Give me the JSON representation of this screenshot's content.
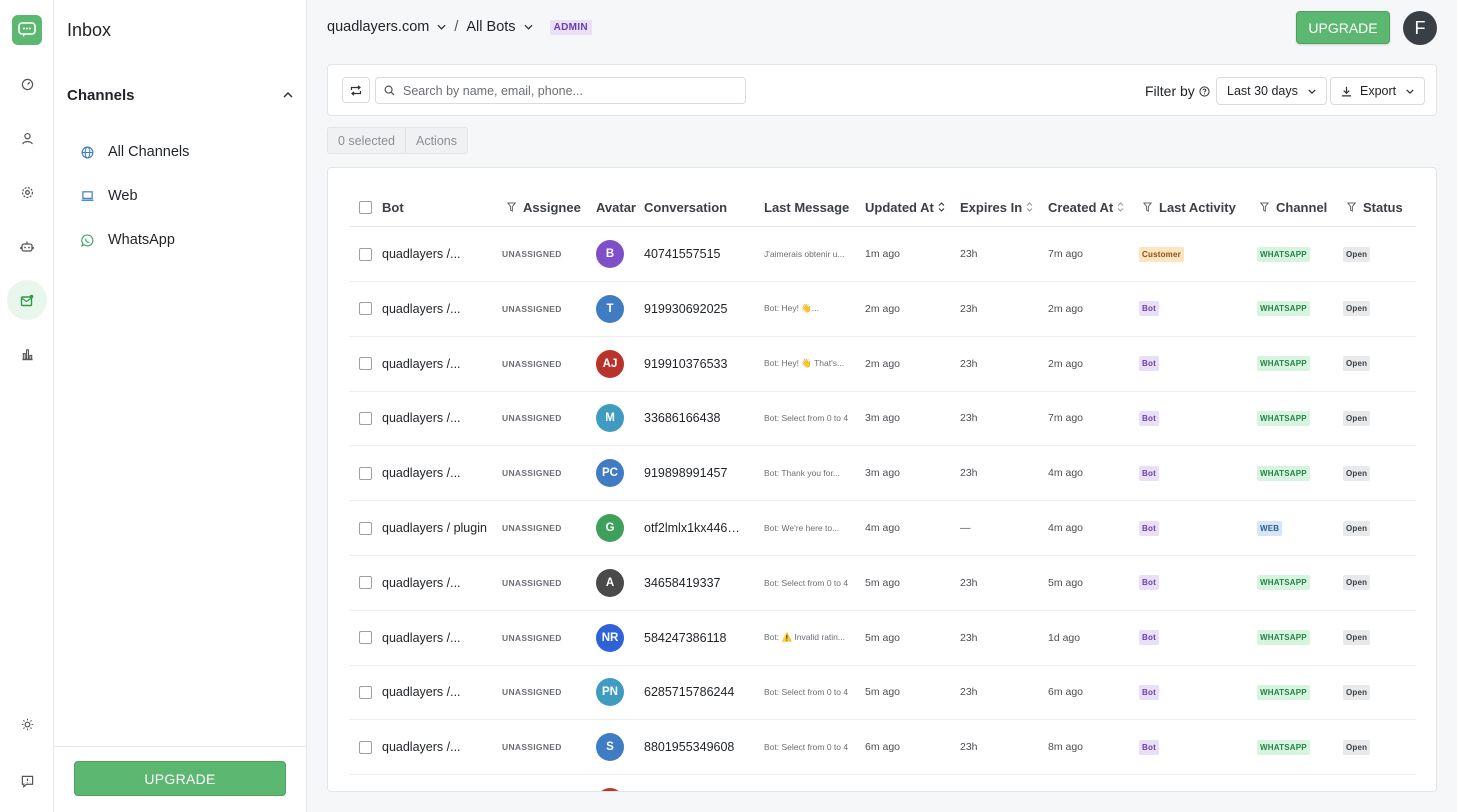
{
  "app": {
    "title": "Inbox"
  },
  "sidebar": {
    "section_title": "Channels",
    "channels": [
      {
        "label": "All Channels",
        "icon": "globe-icon"
      },
      {
        "label": "Web",
        "icon": "laptop-icon"
      },
      {
        "label": "WhatsApp",
        "icon": "whatsapp-icon"
      }
    ],
    "upgrade_label": "UPGRADE"
  },
  "header": {
    "workspace": "quadlayers.com",
    "separator": "/",
    "bots": "All Bots",
    "role_badge": "ADMIN",
    "upgrade_label": "UPGRADE",
    "user_initial": "F"
  },
  "toolbar": {
    "search_placeholder": "Search by name, email, phone...",
    "filter_label": "Filter by",
    "date_range": "Last 30 days",
    "export_label": "Export"
  },
  "selection": {
    "count_label": "0 selected",
    "actions_label": "Actions"
  },
  "table": {
    "columns": [
      "Bot",
      "Assignee",
      "Avatar",
      "Conversation",
      "Last Message",
      "Updated At",
      "Expires In",
      "Created At",
      "Last Activity",
      "Channel",
      "Status"
    ],
    "rows": [
      {
        "bot": "quadlayers /...",
        "assignee": "UNASSIGNED",
        "avatar": "B",
        "avatar_color": "#7e4fc8",
        "conversation": "40741557515",
        "last_message": "J'aimerais obtenir u...",
        "updated": "1m ago",
        "expires": "23h",
        "created": "7m ago",
        "activity": "Customer",
        "activity_kind": "customer",
        "channel": "WHATSAPP",
        "channel_kind": "whatsapp",
        "status": "Open"
      },
      {
        "bot": "quadlayers /...",
        "assignee": "UNASSIGNED",
        "avatar": "T",
        "avatar_color": "#3f7cc4",
        "conversation": "919930692025",
        "last_message": "Bot: Hey! 👋...",
        "updated": "2m ago",
        "expires": "23h",
        "created": "2m ago",
        "activity": "Bot",
        "activity_kind": "bot",
        "channel": "WHATSAPP",
        "channel_kind": "whatsapp",
        "status": "Open"
      },
      {
        "bot": "quadlayers /...",
        "assignee": "UNASSIGNED",
        "avatar": "AJ",
        "avatar_color": "#b8342a",
        "conversation": "919910376533",
        "last_message": "Bot: Hey! 👋 That's...",
        "updated": "2m ago",
        "expires": "23h",
        "created": "2m ago",
        "activity": "Bot",
        "activity_kind": "bot",
        "channel": "WHATSAPP",
        "channel_kind": "whatsapp",
        "status": "Open"
      },
      {
        "bot": "quadlayers /...",
        "assignee": "UNASSIGNED",
        "avatar": "M",
        "avatar_color": "#3f9cc0",
        "conversation": "33686166438",
        "last_message": "Bot: Select from 0 to 4",
        "updated": "3m ago",
        "expires": "23h",
        "created": "7m ago",
        "activity": "Bot",
        "activity_kind": "bot",
        "channel": "WHATSAPP",
        "channel_kind": "whatsapp",
        "status": "Open"
      },
      {
        "bot": "quadlayers /...",
        "assignee": "UNASSIGNED",
        "avatar": "PC",
        "avatar_color": "#3f7cc4",
        "conversation": "919898991457",
        "last_message": "Bot: Thank you for...",
        "updated": "3m ago",
        "expires": "23h",
        "created": "4m ago",
        "activity": "Bot",
        "activity_kind": "bot",
        "channel": "WHATSAPP",
        "channel_kind": "whatsapp",
        "status": "Open"
      },
      {
        "bot": "quadlayers / plugin",
        "assignee": "UNASSIGNED",
        "avatar": "G",
        "avatar_color": "#3ea05a",
        "conversation": "otf2lmlx1kx446v...",
        "last_message": "Bot: We're here to...",
        "updated": "4m ago",
        "expires": "—",
        "created": "4m ago",
        "activity": "Bot",
        "activity_kind": "bot",
        "channel": "WEB",
        "channel_kind": "web",
        "status": "Open"
      },
      {
        "bot": "quadlayers /...",
        "assignee": "UNASSIGNED",
        "avatar": "A",
        "avatar_color": "#4a4a4a",
        "conversation": "34658419337",
        "last_message": "Bot: Select from 0 to 4",
        "updated": "5m ago",
        "expires": "23h",
        "created": "5m ago",
        "activity": "Bot",
        "activity_kind": "bot",
        "channel": "WHATSAPP",
        "channel_kind": "whatsapp",
        "status": "Open"
      },
      {
        "bot": "quadlayers /...",
        "assignee": "UNASSIGNED",
        "avatar": "NR",
        "avatar_color": "#2e63d8",
        "conversation": "584247386118",
        "last_message": "Bot: ⚠️ Invalid ratin...",
        "updated": "5m ago",
        "expires": "23h",
        "created": "1d ago",
        "activity": "Bot",
        "activity_kind": "bot",
        "channel": "WHATSAPP",
        "channel_kind": "whatsapp",
        "status": "Open"
      },
      {
        "bot": "quadlayers /...",
        "assignee": "UNASSIGNED",
        "avatar": "PN",
        "avatar_color": "#3f9cc0",
        "conversation": "6285715786244",
        "last_message": "Bot: Select from 0 to 4",
        "updated": "5m ago",
        "expires": "23h",
        "created": "6m ago",
        "activity": "Bot",
        "activity_kind": "bot",
        "channel": "WHATSAPP",
        "channel_kind": "whatsapp",
        "status": "Open"
      },
      {
        "bot": "quadlayers /...",
        "assignee": "UNASSIGNED",
        "avatar": "S",
        "avatar_color": "#3f7cc4",
        "conversation": "8801955349608",
        "last_message": "Bot: Select from 0 to 4",
        "updated": "6m ago",
        "expires": "23h",
        "created": "8m ago",
        "activity": "Bot",
        "activity_kind": "bot",
        "channel": "WHATSAPP",
        "channel_kind": "whatsapp",
        "status": "Open"
      }
    ]
  },
  "colors": {
    "accent": "#5cb870",
    "rail_active_bg": "#e9f6ec"
  }
}
